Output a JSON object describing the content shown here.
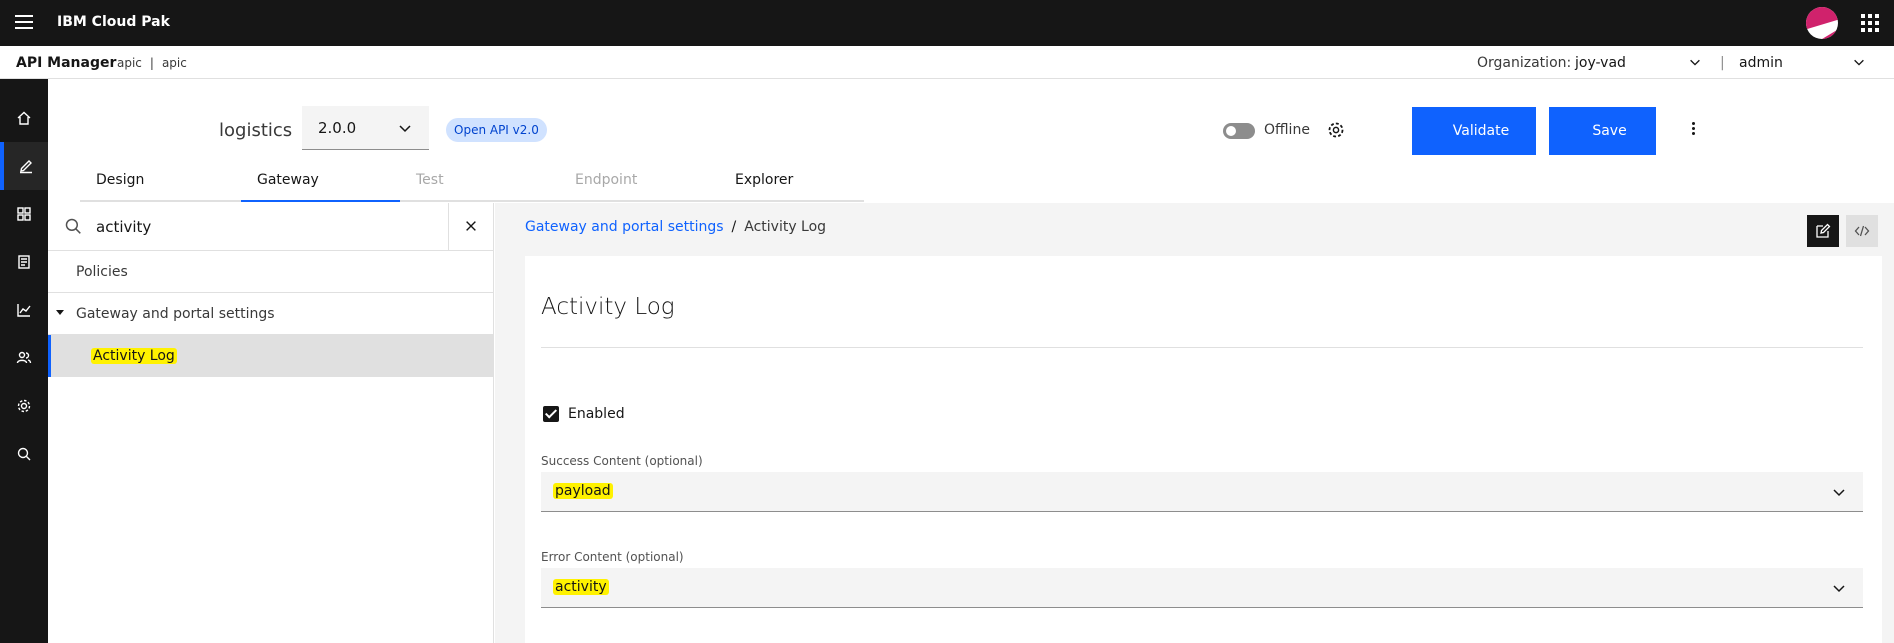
{
  "topbar": {
    "brand": "IBM Cloud Pak"
  },
  "subbar": {
    "app_name": "API Manager",
    "crumb1": "apic",
    "crumb_sep": "|",
    "crumb2": "apic",
    "org_label": "Organization:",
    "org_value": "joy-vad",
    "divider": "|",
    "user_value": "admin"
  },
  "header": {
    "api_title": "logistics",
    "version": "2.0.0",
    "spec_tag": "Open API v2.0",
    "offline_label": "Offline",
    "validate_label": "Validate",
    "save_label": "Save"
  },
  "tabs": [
    {
      "label": "Design",
      "state": "normal"
    },
    {
      "label": "Gateway",
      "state": "active"
    },
    {
      "label": "Test",
      "state": "disabled"
    },
    {
      "label": "Endpoint",
      "state": "disabled"
    },
    {
      "label": "Explorer",
      "state": "normal"
    }
  ],
  "search": {
    "value": "activity"
  },
  "tree": {
    "policies": "Policies",
    "gateway_settings": "Gateway and portal settings",
    "activity_log": "Activity Log"
  },
  "breadcrumb": {
    "parent": "Gateway and portal settings",
    "sep": "/",
    "current": "Activity Log"
  },
  "form": {
    "title": "Activity Log",
    "enabled_label": "Enabled",
    "enabled_checked": true,
    "success_label": "Success Content (optional)",
    "success_value": "payload",
    "error_label": "Error Content (optional)",
    "error_value": "activity"
  },
  "colors": {
    "primary": "#0f62fe",
    "dark": "#161616",
    "highlight": "#fff200",
    "tag_bg": "#d0e2ff"
  },
  "icons": {
    "rail": [
      "home-icon",
      "edit-icon",
      "apps-icon",
      "document-icon",
      "analytics-icon",
      "users-icon",
      "settings-icon",
      "search-icon"
    ]
  }
}
